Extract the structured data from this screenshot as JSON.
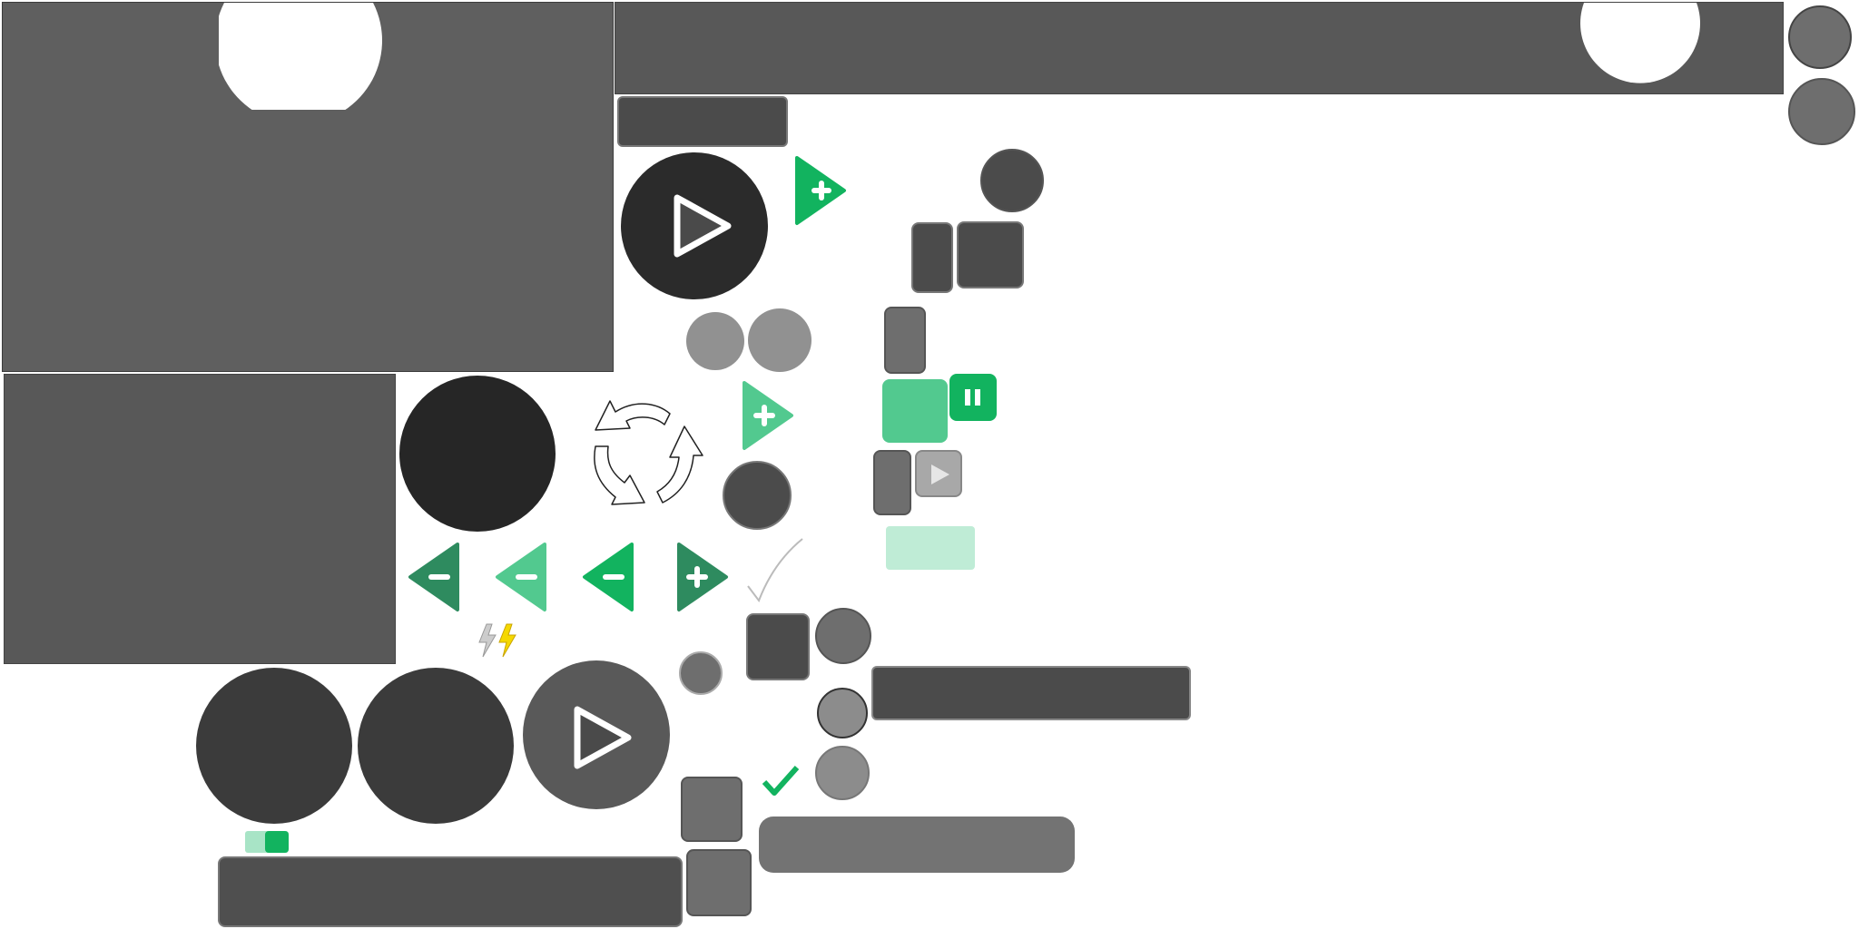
{
  "atlas": {
    "theme": {
      "panel": "#5f5f5f",
      "panel_dark": "#585858",
      "button_dark": "#4b4b4b",
      "button_mid": "#6e6e6e",
      "button_light": "#8c8c8c",
      "circle_black": "#262626",
      "circle_charcoal": "#3b3b3b",
      "green": "#12b35f",
      "green_light": "#52c98f",
      "green_dark": "#2e8b5f",
      "green_pale": "#bfecd6",
      "white": "#ffffff"
    },
    "icons": {
      "play": "play-icon",
      "plus": "plus-icon",
      "minus": "minus-icon",
      "pause": "pause-icon",
      "refresh": "recycle-arrows-icon",
      "check": "check-icon",
      "lightning": "lightning-icon"
    }
  }
}
